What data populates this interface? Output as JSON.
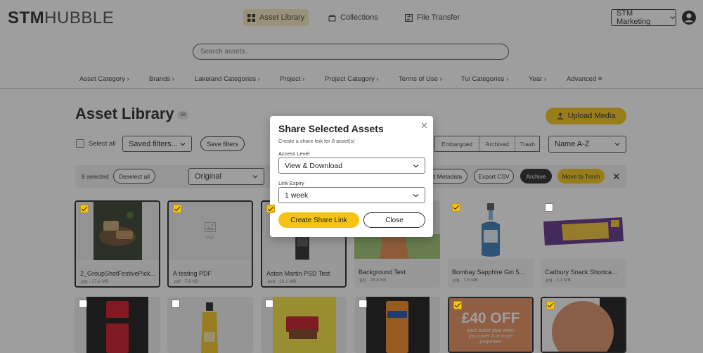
{
  "brand": {
    "logo_bold": "STM",
    "logo_light": "HUBBLE"
  },
  "nav": {
    "items": [
      {
        "label": "Asset Library",
        "icon": "grid-icon",
        "active": true
      },
      {
        "label": "Collections",
        "icon": "collection-icon",
        "active": false
      },
      {
        "label": "File Transfer",
        "icon": "transfer-icon",
        "active": false
      }
    ],
    "workspace": "STM Marketing",
    "avatar_icon": "user-circle-icon"
  },
  "search": {
    "placeholder": "Search assets..."
  },
  "filters": [
    "Asset Category",
    "Brands",
    "Lakeland Categories",
    "Project",
    "Project Category",
    "Terms of Use",
    "Tui Categories",
    "Year",
    "Advanced"
  ],
  "page": {
    "title": "Asset Library",
    "count": "38",
    "upload_label": "Upload Media"
  },
  "toolbar": {
    "select_all": "Select all",
    "saved_filters": "Saved filters...",
    "save_filters": "Save filters",
    "status_tabs": [
      "Embargoed",
      "Archived",
      "Trash"
    ],
    "sort": "Name A-Z"
  },
  "bulk": {
    "selected": "8 selected",
    "deselect": "Deselect all",
    "version": "Original",
    "edit_metadata": "Edit Metadata",
    "export_csv": "Export CSV",
    "archive": "Archive",
    "trash": "Move to Trash"
  },
  "assets": [
    {
      "name": "2_GroupShotFestivePick...",
      "meta": ".jpg · 17.8 MB",
      "selected": true
    },
    {
      "name": "A testing PDF",
      "meta": ".pdf · 7.8 KB",
      "selected": true,
      "placeholder": "PDF"
    },
    {
      "name": "Aston Martin PSD Test",
      "meta": ".psd · 16.1 MB",
      "selected": true
    },
    {
      "name": "Background Test",
      "meta": ".jpg · 28.8 KB",
      "selected": false
    },
    {
      "name": "Bombay Sapphire Gin 5...",
      "meta": ".jpg · 1.5 MB",
      "selected": true
    },
    {
      "name": "Cadbury Snack Shortca...",
      "meta": ".jpg · 1.1 MB",
      "selected": false
    }
  ],
  "assets_row2": [
    {
      "selected": false
    },
    {
      "selected": false
    },
    {
      "selected": false
    },
    {
      "selected": false
    },
    {
      "selected": true,
      "text_big": "£40 OFF",
      "text_small": "each boiler plan when you cover 6 or more properties"
    },
    {
      "selected": true
    }
  ],
  "modal": {
    "title": "Share Selected Assets",
    "subtitle": "Create a share link for 8 asset(s)",
    "access_label": "Access Level",
    "access_value": "View & Download",
    "expiry_label": "Link Expiry",
    "expiry_value": "1 week",
    "create_label": "Create Share Link",
    "close_label": "Close"
  },
  "colors": {
    "accent": "#f6c312",
    "dark": "#222222",
    "overlay": "rgba(40,40,40,0.45)"
  }
}
